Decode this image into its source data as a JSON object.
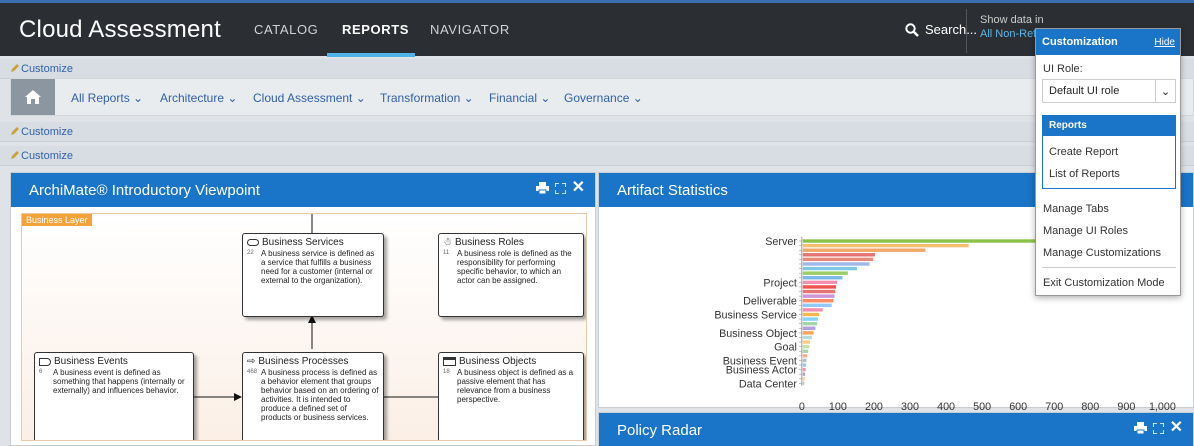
{
  "header": {
    "title": "Cloud Assessment",
    "tabs": [
      {
        "label": "CATALOG",
        "active": false
      },
      {
        "label": "REPORTS",
        "active": true
      },
      {
        "label": "NAVIGATOR",
        "active": false
      }
    ],
    "search_label": "Search...",
    "show_data_label": "Show data in",
    "show_data_value": "All Non-Ref"
  },
  "customize_label": "Customize",
  "menu": {
    "home_icon": "home-icon",
    "items": [
      "All Reports",
      "Architecture",
      "Cloud Assessment",
      "Transformation",
      "Financial",
      "Governance"
    ]
  },
  "archimate": {
    "title": "ArchiMate® Introductory Viewpoint",
    "layer_label": "Business Layer",
    "boxes": [
      {
        "name": "Business Services",
        "count": "22",
        "text": "A business service is defined as a service that fulfills a business need for a customer (internal or external to the organization)."
      },
      {
        "name": "Business Roles",
        "count": "11",
        "text": "A business role is defined as the responsibility for performing specific behavior, to which an actor can be assigned."
      },
      {
        "name": "Business Events",
        "count": "6",
        "text": "A business event is defined as something that happens (internally or externally) and influences behavior."
      },
      {
        "name": "Business Processes",
        "count": "468",
        "text": "A business process is defined as a behavior element that groups behavior based on an ordering of activities. It is intended to produce a defined set of products or business services."
      },
      {
        "name": "Business Objects",
        "count": "18",
        "text": "A business object is defined as a passive element that has relevance from a business perspective."
      }
    ]
  },
  "artifact": {
    "title": "Artifact Statistics"
  },
  "policy": {
    "title": "Policy Radar"
  },
  "chart_data": {
    "type": "bar",
    "orientation": "horizontal",
    "title": "Artifact Statistics",
    "categories": [
      "Server",
      "",
      "",
      "",
      "",
      "",
      "",
      "",
      "",
      "Project",
      "",
      "",
      "",
      "Deliverable",
      "",
      "",
      "Business Service",
      "",
      "",
      "",
      "Business Object",
      "",
      "",
      "Goal",
      "",
      "",
      "Business Event",
      "",
      "Business Actor",
      "",
      "",
      "Data Center"
    ],
    "values": [
      1000,
      460,
      340,
      200,
      195,
      185,
      150,
      125,
      110,
      95,
      92,
      90,
      88,
      85,
      80,
      55,
      45,
      42,
      40,
      35,
      30,
      25,
      20,
      18,
      15,
      12,
      10,
      9,
      8,
      6,
      5,
      4
    ],
    "colors": [
      "#8bc34a",
      "#f5c06f",
      "#f0a868",
      "#e57373",
      "#e88a7a",
      "#9fb8e8",
      "#7ec8e3",
      "#9ccc65",
      "#7db9e8",
      "#f48fb1",
      "#ef5350",
      "#e57373",
      "#ce93d8",
      "#ff8a65",
      "#90caf9",
      "#f48fb1",
      "#ffb74d",
      "#81d4fa",
      "#a5d6a7",
      "#b39ddb",
      "#f7a35c",
      "#b2dfdb",
      "#ffcc80",
      "#c5e1a5",
      "#a5d6a7",
      "#ffab91",
      "#b0bec5",
      "#90caf9",
      "#f48fb1",
      "#b39ddb",
      "#ffcc80",
      "#a5d6a7"
    ],
    "xlim": [
      0,
      1000
    ],
    "xticks": [
      "0",
      "100",
      "200",
      "300",
      "400",
      "500",
      "600",
      "700",
      "800",
      "900",
      "1,000"
    ]
  },
  "customization": {
    "title": "Customization",
    "hide_label": "Hide",
    "ui_role_label": "UI Role:",
    "ui_role_value": "Default UI role",
    "reports_header": "Reports",
    "reports_links": [
      "Create Report",
      "List of Reports"
    ],
    "links": [
      "Manage Tabs",
      "Manage UI Roles",
      "Manage Customizations"
    ],
    "exit_label": "Exit Customization Mode"
  }
}
